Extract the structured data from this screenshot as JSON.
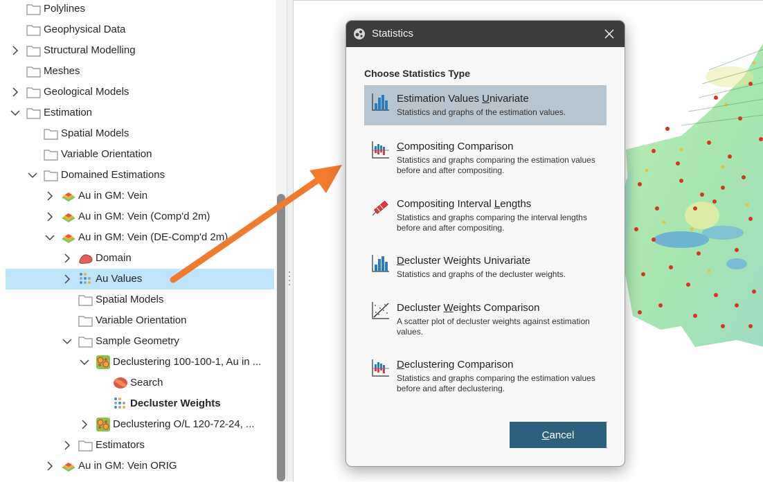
{
  "tree": {
    "items": [
      {
        "label": "Polylines"
      },
      {
        "label": "Geophysical Data"
      },
      {
        "label": "Structural Modelling"
      },
      {
        "label": "Meshes"
      },
      {
        "label": "Geological Models"
      },
      {
        "label": "Estimation"
      },
      {
        "label": "Spatial Models"
      },
      {
        "label": "Variable Orientation"
      },
      {
        "label": "Domained Estimations"
      },
      {
        "label": "Au in GM: Vein"
      },
      {
        "label": "Au in GM: Vein (Comp'd 2m)"
      },
      {
        "label": "Au in GM: Vein (DE-Comp'd 2m)"
      },
      {
        "label": "Domain"
      },
      {
        "label": "Au Values"
      },
      {
        "label": "Spatial Models"
      },
      {
        "label": "Variable Orientation"
      },
      {
        "label": "Sample Geometry"
      },
      {
        "label": "Declustering 100-100-1, Au in ..."
      },
      {
        "label": "Search"
      },
      {
        "label": "Decluster Weights"
      },
      {
        "label": "Declustering O/L 120-72-24, ..."
      },
      {
        "label": "Estimators"
      },
      {
        "label": "Au in GM: Vein ORIG"
      }
    ]
  },
  "dialog": {
    "title": "Statistics",
    "heading": "Choose Statistics Type",
    "options": [
      {
        "pre": "Estimation Values ",
        "u": "U",
        "post": "nivariate",
        "desc": "Statistics and graphs of the estimation values."
      },
      {
        "pre": "",
        "u": "C",
        "post": "ompositing Comparison",
        "desc": "Statistics and graphs comparing the estimation values before and after compositing."
      },
      {
        "pre": "Compositing Interval ",
        "u": "L",
        "post": "engths",
        "desc": "Statistics and graphs comparing the interval lengths before and after compositing."
      },
      {
        "pre": "",
        "u": "D",
        "post": "ecluster Weights Univariate",
        "desc": "Statistics and graphs of the decluster weights."
      },
      {
        "pre": "Decluster ",
        "u": "W",
        "post": "eights Comparison",
        "desc": "A scatter plot of decluster weights against estimation values."
      },
      {
        "pre": "",
        "u": "D",
        "post": "eclustering Comparison",
        "desc": "Statistics and graphs comparing the estimation values before and after declustering."
      }
    ],
    "cancel_u": "C",
    "cancel_rest": "ancel"
  },
  "colors": {
    "selection": "#bfe3f8",
    "option_selected": "#b7c5d0",
    "titlebar": "#3c3c3c",
    "cancel_button": "#2e5f7e",
    "arrow": "#f07a2e"
  }
}
